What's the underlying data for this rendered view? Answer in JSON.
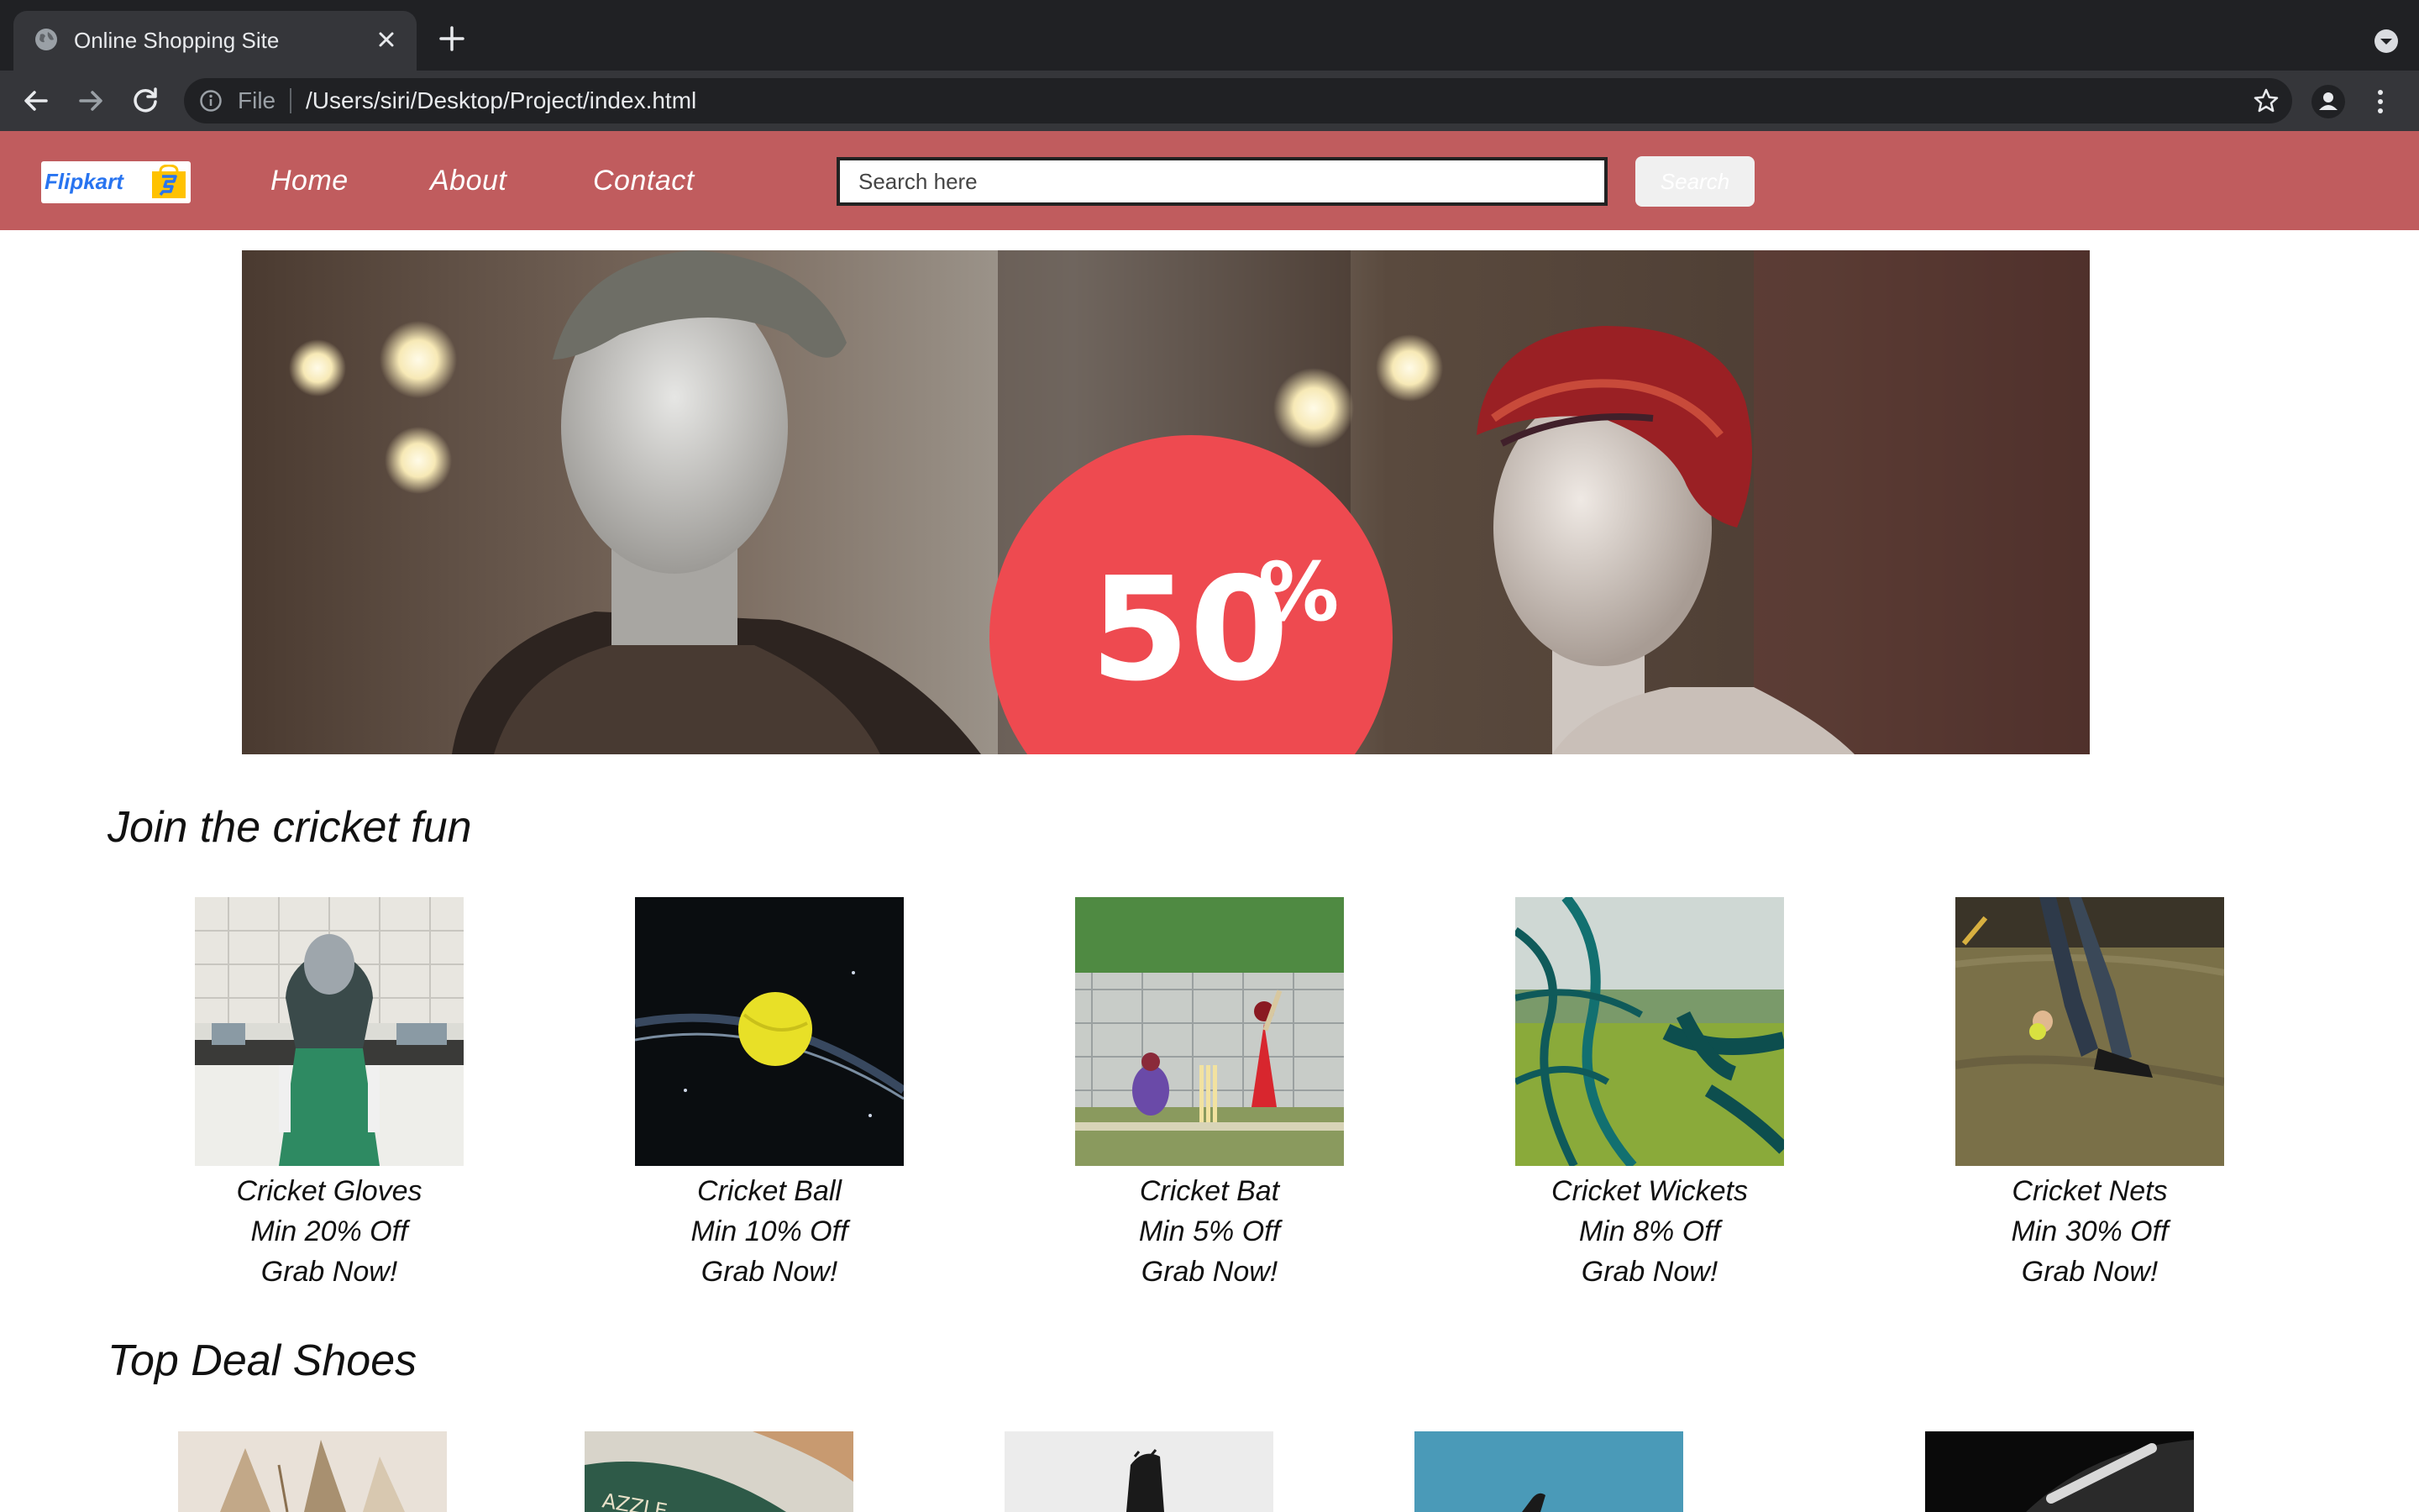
{
  "browser": {
    "tab_title": "Online Shopping Site",
    "omnibox_scheme": "File",
    "omnibox_url": "/Users/siri/Desktop/Project/index.html"
  },
  "header": {
    "logo_text": "Flipkart",
    "nav": [
      "Home",
      "About",
      "Contact"
    ],
    "search_placeholder": "Search here",
    "search_button": "Search"
  },
  "hero": {
    "badge_text": "50",
    "badge_suffix": "%"
  },
  "sections": [
    {
      "title": "Join the cricket fun",
      "products": [
        {
          "name": "Cricket Gloves",
          "offer": "Min 20% Off",
          "cta": "Grab Now!"
        },
        {
          "name": "Cricket Ball",
          "offer": "Min 10% Off",
          "cta": "Grab Now!"
        },
        {
          "name": "Cricket Bat",
          "offer": "Min 5% Off",
          "cta": "Grab Now!"
        },
        {
          "name": "Cricket Wickets",
          "offer": "Min 8% Off",
          "cta": "Grab Now!"
        },
        {
          "name": "Cricket Nets",
          "offer": "Min 30% Off",
          "cta": "Grab Now!"
        }
      ]
    },
    {
      "title": "Top Deal Shoes"
    }
  ],
  "colors": {
    "header_bg": "#c05c5e",
    "chrome_dark": "#202124",
    "chrome_toolbar": "#35363a",
    "badge_red": "#ee4a50"
  }
}
